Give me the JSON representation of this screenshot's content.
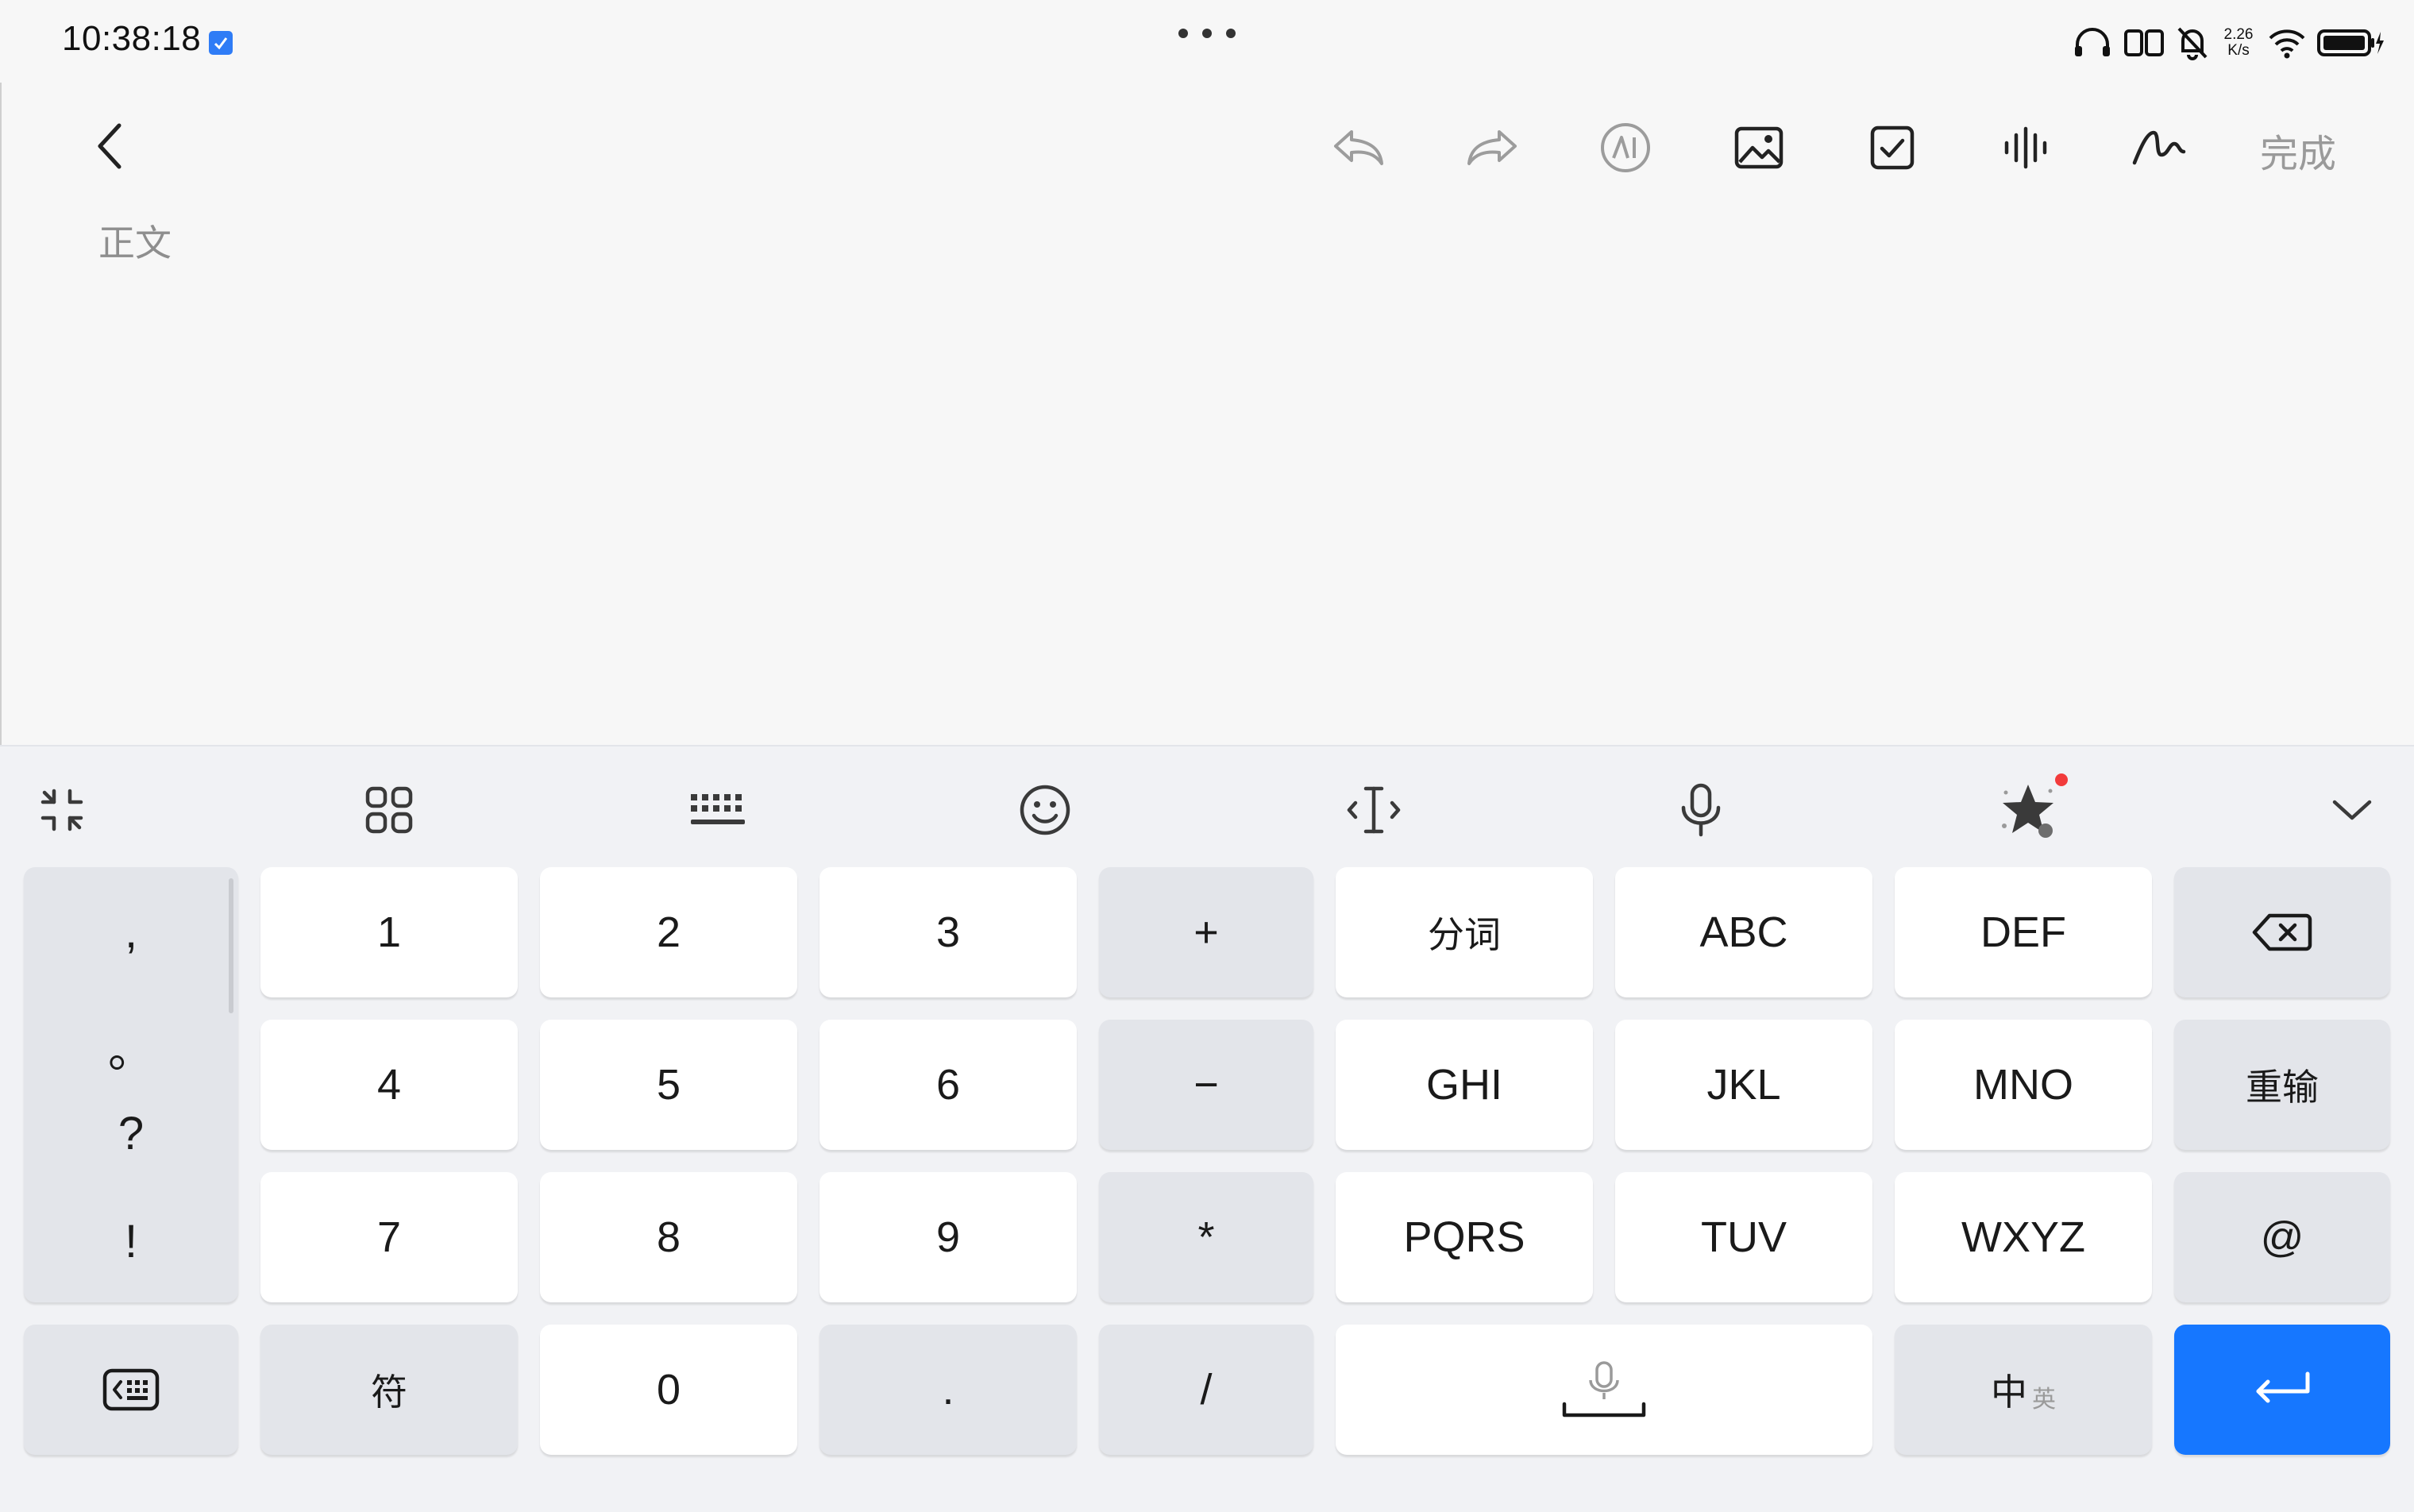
{
  "status_bar": {
    "time": "10:38:18",
    "net_speed_value": "2.26",
    "net_speed_unit": "K/s"
  },
  "editor": {
    "done_label": "完成",
    "body_placeholder": "正文",
    "toolbar_icons": [
      "undo-icon",
      "redo-icon",
      "ai-icon",
      "image-icon",
      "checkbox-icon",
      "voice-wave-icon",
      "handwriting-icon"
    ]
  },
  "keyboard": {
    "toolbar_icons": [
      "collapse-icon",
      "apps-grid-icon",
      "keyboard-layout-icon",
      "emoji-icon",
      "cursor-move-icon",
      "microphone-icon",
      "sticker-icon",
      "hide-keyboard-icon"
    ],
    "punctuation": [
      ",",
      "。",
      "?",
      "!"
    ],
    "rows": {
      "r1": {
        "k1": "1",
        "k2": "2",
        "k3": "3",
        "op": "+",
        "a": "分词",
        "b": "ABC",
        "c": "DEF"
      },
      "r2": {
        "k1": "4",
        "k2": "5",
        "k3": "6",
        "op": "−",
        "a": "GHI",
        "b": "JKL",
        "c": "MNO",
        "side": "重输"
      },
      "r3": {
        "k1": "7",
        "k2": "8",
        "k3": "9",
        "op": "*",
        "a": "PQRS",
        "b": "TUV",
        "c": "WXYZ",
        "side": "@"
      },
      "r4": {
        "sym": "符",
        "zero": "0",
        "dot": ".",
        "slash": "/",
        "lang_main": "中",
        "lang_sub": "英"
      }
    },
    "accent_color": "#1677ff"
  }
}
